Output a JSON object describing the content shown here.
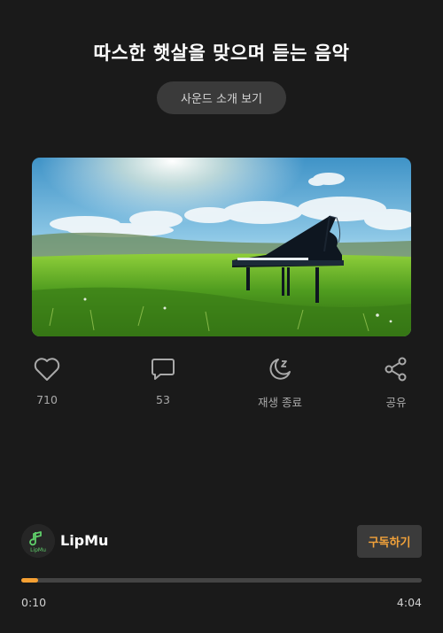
{
  "header": {
    "title": "따스한 햇살을 맞으며 듣는 음악",
    "intro_button": "사운드 소개 보기"
  },
  "artwork": {
    "description_icon": "piano-meadow-artwork"
  },
  "actions": {
    "like": {
      "icon": "heart-icon",
      "label": "710"
    },
    "comment": {
      "icon": "comment-icon",
      "label": "53"
    },
    "sleep_timer": {
      "icon": "moon-sleep-icon",
      "label": "재생 종료"
    },
    "share": {
      "icon": "share-icon",
      "label": "공유"
    }
  },
  "artist": {
    "name": "LipMu",
    "avatar_text": "LipMu",
    "subscribe_label": "구독하기"
  },
  "player": {
    "progress_fraction": 0.041,
    "current_time": "0:10",
    "total_time": "4:04"
  },
  "colors": {
    "background": "#1a1a1a",
    "accent": "#f5a033",
    "muted_text": "#a9a9a9"
  }
}
